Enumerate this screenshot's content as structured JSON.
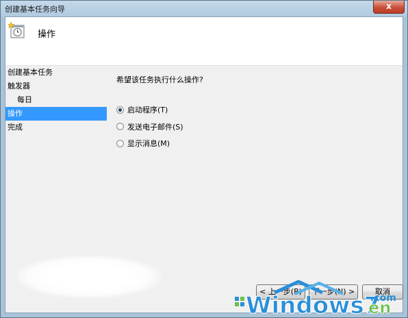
{
  "window": {
    "title": "创建基本任务向导",
    "close_label": "x"
  },
  "header": {
    "title": "操作",
    "icon": "task-clock-icon"
  },
  "steps": [
    {
      "label": "创建基本任务"
    },
    {
      "label": "触发器"
    },
    {
      "label": "每日"
    },
    {
      "label": "操作"
    },
    {
      "label": "完成"
    }
  ],
  "content": {
    "question": "希望该任务执行什么操作?",
    "options": [
      {
        "label": "启动程序(T)",
        "checked": true
      },
      {
        "label": "发送电子邮件(S)",
        "checked": false
      },
      {
        "label": "显示消息(M)",
        "checked": false
      }
    ]
  },
  "buttons": {
    "back": "< 上一步(B)",
    "next": "下一步(N) >",
    "cancel": "取消"
  },
  "watermark": {
    "main": "Windows7",
    "suffix": "en",
    "domain": ".com"
  }
}
